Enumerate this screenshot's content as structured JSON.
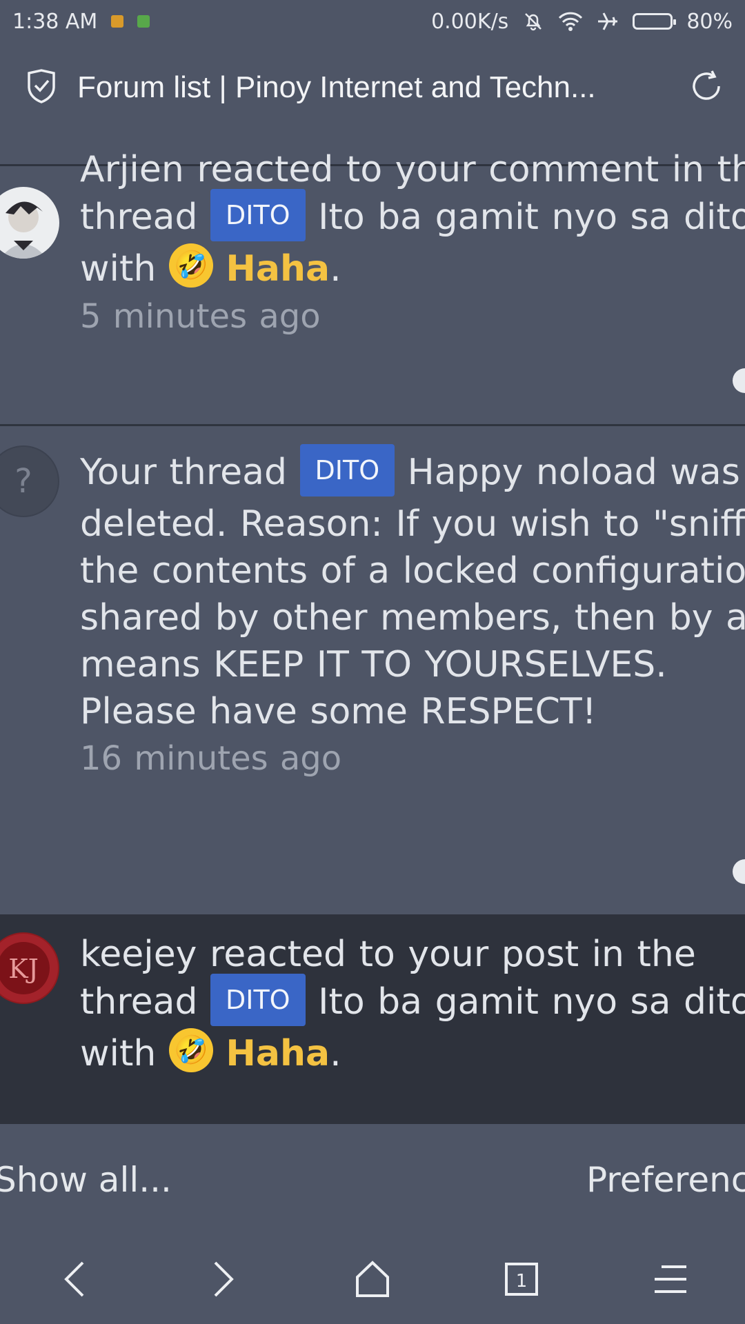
{
  "status_bar": {
    "time": "1:38 AM",
    "net_speed": "0.00K/s",
    "battery": "80%"
  },
  "browser": {
    "title": "Forum list | Pinoy Internet and Techn..."
  },
  "notifications": [
    {
      "pre": "Arjien reacted to your comment in the thread ",
      "tag": "DITO",
      "mid": " Ito ba gamit nyo sa dito with ",
      "reaction": "Haha",
      "end": ".",
      "time": "5 minutes ago"
    },
    {
      "pre": "Your thread ",
      "tag": "DITO",
      "mid": " Happy noload was deleted. Reason: If you wish to \"sniff\" the contents of a locked configuration shared by other members, then by all means KEEP IT TO YOURSELVES. Please have some RESPECT!",
      "time": "16 minutes ago"
    },
    {
      "pre": "keejey reacted to your post in the thread ",
      "tag": "DITO",
      "mid": " Ito ba gamit nyo sa dito with ",
      "reaction": "Haha",
      "end": "."
    }
  ],
  "footer": {
    "show_all": "Show all...",
    "preferences": "Preferenc"
  },
  "colors": {
    "background": "#4e5566",
    "tag": "#3a66c6",
    "reaction": "#f4c242",
    "unread_row": "#2e323c"
  }
}
